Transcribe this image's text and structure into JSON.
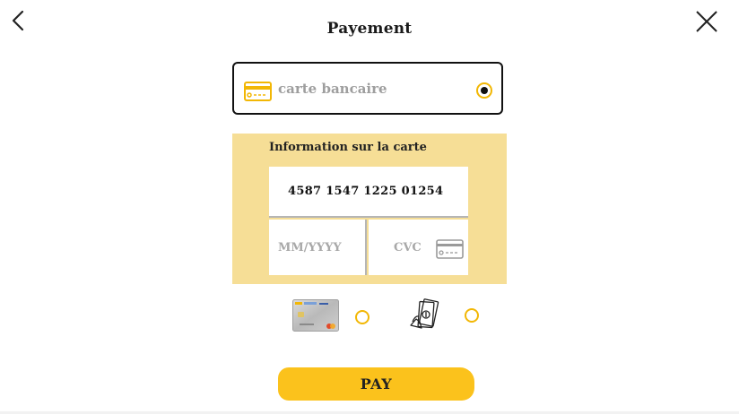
{
  "header": {
    "title": "Payement",
    "back_icon": "chevron-left-icon",
    "close_icon": "close-icon"
  },
  "payment_method": {
    "label": "carte bancaire",
    "icon": "credit-card-icon",
    "selected": true
  },
  "card_info": {
    "heading": "Information sur la carte",
    "card_number": "4587 1547 1225 01254",
    "expiry_placeholder": "MM/YYYY",
    "cvc_placeholder": "CVC",
    "cvc_icon": "credit-card-icon"
  },
  "alternative_options": [
    {
      "name": "bank-card-image",
      "selected": false
    },
    {
      "name": "cash-icon",
      "selected": false
    }
  ],
  "actions": {
    "pay_label": "PAY"
  },
  "colors": {
    "accent": "#fbc21c",
    "panel": "#f6de96",
    "radio_border": "#f2b705"
  }
}
